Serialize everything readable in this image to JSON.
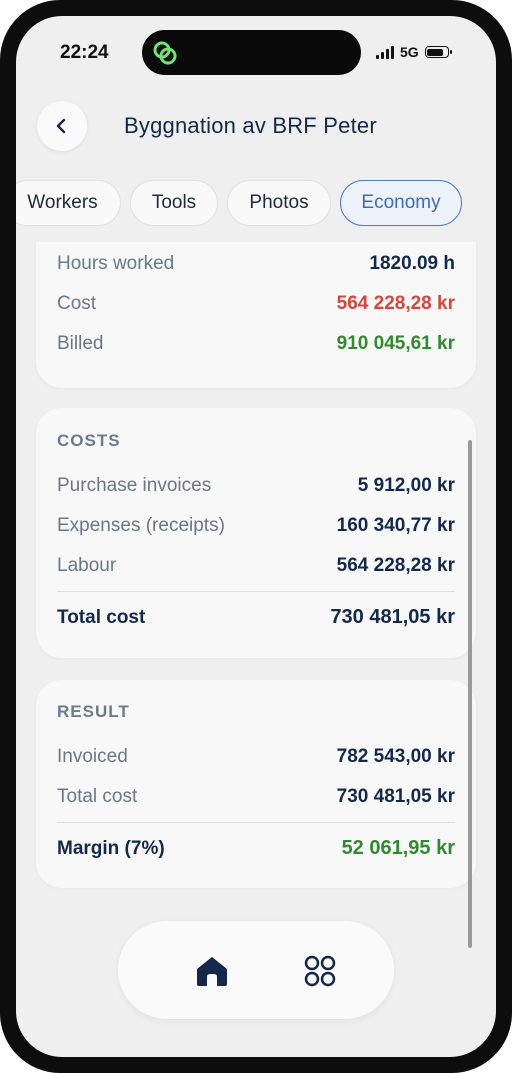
{
  "status_bar": {
    "time": "22:24",
    "network": "5G"
  },
  "header": {
    "title": "Byggnation av BRF Peter",
    "back_icon": "chevron-left-icon"
  },
  "tabs": [
    {
      "label": "Workers",
      "active": false
    },
    {
      "label": "Tools",
      "active": false
    },
    {
      "label": "Photos",
      "active": false
    },
    {
      "label": "Economy",
      "active": true
    }
  ],
  "summary": {
    "rows": [
      {
        "label": "Hours worked",
        "value": "1820.09 h"
      },
      {
        "label": "Cost",
        "value": "564 228,28 kr",
        "color": "#d9433a"
      },
      {
        "label": "Billed",
        "value": "910 045,61 kr",
        "color": "#2f8b2f"
      }
    ]
  },
  "costs": {
    "heading": "COSTS",
    "rows": [
      {
        "label": "Purchase invoices",
        "value": "5 912,00 kr"
      },
      {
        "label": "Expenses (receipts)",
        "value": "160 340,77 kr"
      },
      {
        "label": "Labour",
        "value": "564 228,28 kr"
      }
    ],
    "total": {
      "label": "Total cost",
      "value": "730 481,05 kr"
    }
  },
  "result": {
    "heading": "RESULT",
    "rows": [
      {
        "label": "Invoiced",
        "value": "782 543,00 kr"
      },
      {
        "label": "Total cost",
        "value": "730 481,05 kr"
      }
    ],
    "total": {
      "label": "Margin (7%)",
      "value": "52 061,95 kr",
      "color": "#2f8b2f"
    }
  },
  "bottom_nav": {
    "items": [
      {
        "icon": "home-icon"
      },
      {
        "icon": "apps-grid-icon"
      }
    ]
  },
  "colors": {
    "accent": "#3d6bc4",
    "navy": "#13294b",
    "negative": "#d9433a",
    "positive": "#2f8b2f",
    "island_logo": "#6fe36f"
  }
}
